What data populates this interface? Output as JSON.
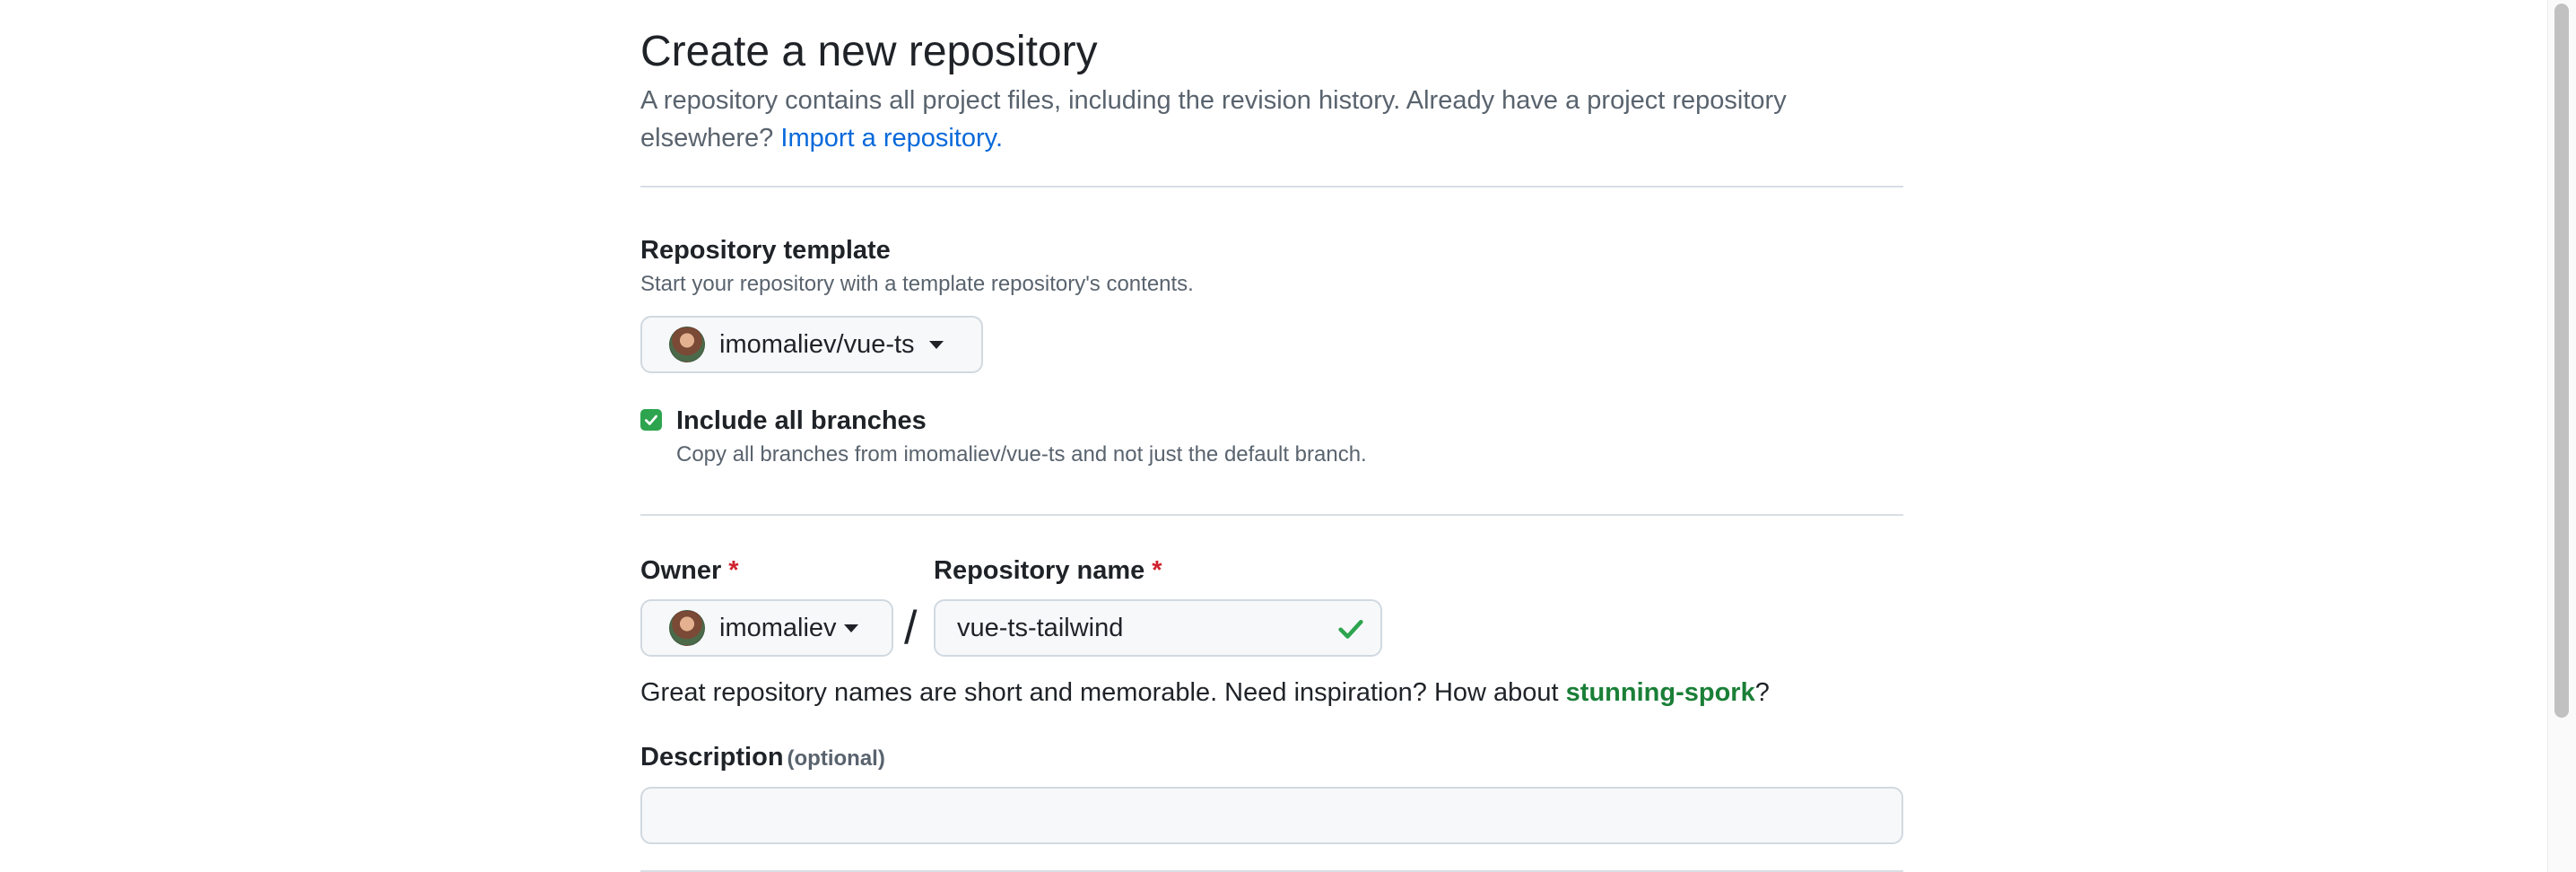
{
  "header": {
    "title": "Create a new repository",
    "subtitle": "A repository contains all project files, including the revision history. Already have a project repository elsewhere?",
    "import_link": "Import a repository."
  },
  "template": {
    "label": "Repository template",
    "hint": "Start your repository with a template repository's contents.",
    "selected": "imomaliev/vue-ts"
  },
  "branches": {
    "checked": true,
    "label": "Include all branches",
    "hint": "Copy all branches from imomaliev/vue-ts and not just the default branch."
  },
  "owner": {
    "label": "Owner",
    "required_mark": "*",
    "selected": "imomaliev"
  },
  "separator": "/",
  "repo_name": {
    "label": "Repository name",
    "required_mark": "*",
    "value": "vue-ts-tailwind",
    "valid_icon": "check-icon"
  },
  "name_hint": {
    "text": "Great repository names are short and memorable. Need inspiration? How about",
    "suggestion": "stunning-spork",
    "end": "?"
  },
  "description": {
    "label": "Description",
    "optional": "(optional)",
    "value": ""
  },
  "colors": {
    "link": "#0969da",
    "required": "#cf222e",
    "success": "#1a7f37",
    "checkbox": "#2da44e"
  }
}
